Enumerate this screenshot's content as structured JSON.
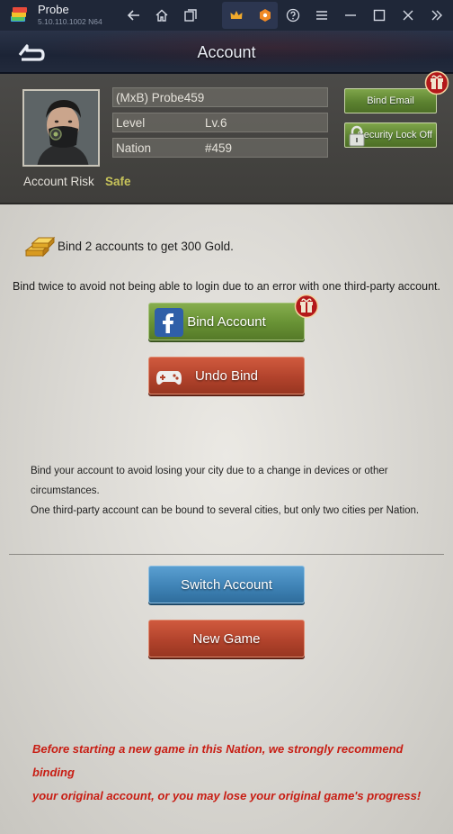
{
  "emulator": {
    "app_title": "Probe",
    "version": "5.10.110.1002  N64"
  },
  "header": {
    "title": "Account"
  },
  "profile": {
    "name": "(MxB) Probe459",
    "level_label": "Level",
    "level_value": "Lv.6",
    "nation_label": "Nation",
    "nation_value": "#459",
    "risk_label": "Account Risk",
    "risk_value": "Safe",
    "bind_email_label": "Bind Email",
    "security_lock_label": "Security Lock Off"
  },
  "main": {
    "gold_text": "Bind 2 accounts to get 300 Gold.",
    "notice": "Bind twice to avoid not being able to login due to an error with one third-party account.",
    "bind_account_label": "Bind Account",
    "undo_bind_label": "Undo Bind",
    "info_line_1": "Bind your account to avoid losing your city due to a change in devices or other",
    "info_line_2": "circumstances.",
    "info_line_3": "One third-party account can be bound to several cities, but only two cities per Nation.",
    "switch_account_label": "Switch Account",
    "new_game_label": "New Game",
    "warning_line_1": "Before starting a new game in this Nation, we strongly recommend binding",
    "warning_line_2": "your original account, or you may lose your original game's progress!"
  },
  "colors": {
    "warning": "#c81d13",
    "safe": "#c7c35a",
    "green_button": "#6a9436",
    "red_button": "#b2432c",
    "blue_button": "#3f83b6"
  }
}
